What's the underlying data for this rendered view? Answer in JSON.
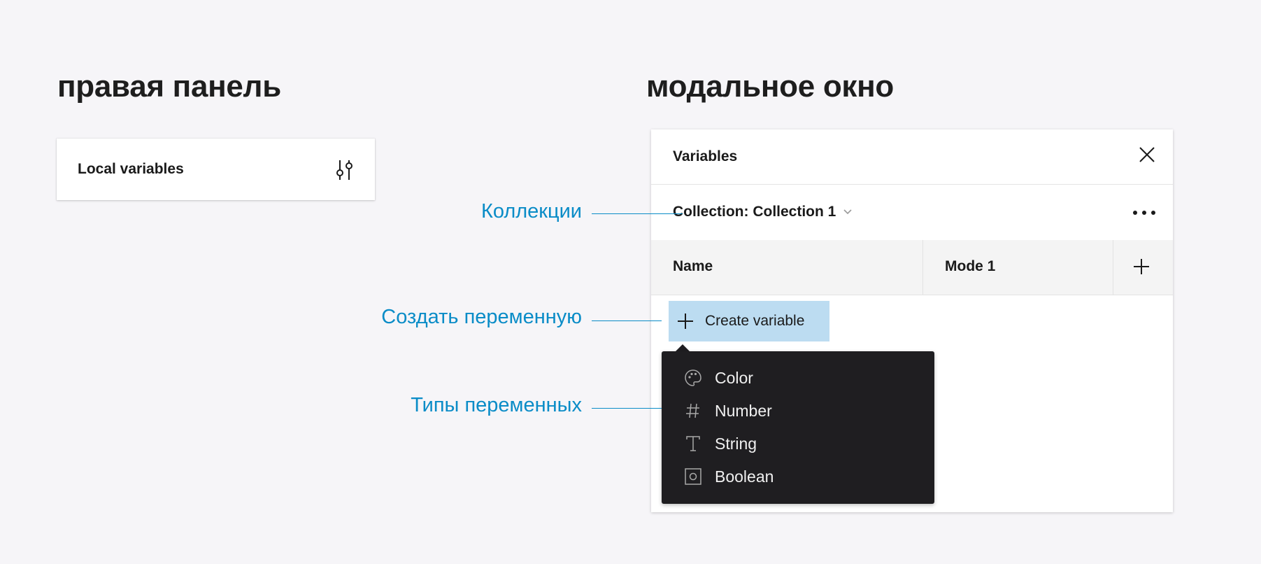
{
  "headings": {
    "left": "правая панель",
    "right": "модальное окно"
  },
  "right_panel": {
    "title": "Local variables",
    "icon": "sliders-icon"
  },
  "modal": {
    "title": "Variables",
    "close_icon": "close-icon",
    "collection_label": "Collection: Collection 1",
    "more_icon": "more-icon",
    "columns": {
      "name": "Name",
      "mode": "Mode 1"
    },
    "add_mode_icon": "plus-icon",
    "create_button": "Create variable"
  },
  "dropdown": {
    "items": [
      {
        "label": "Color",
        "icon": "palette-icon"
      },
      {
        "label": "Number",
        "icon": "hash-icon"
      },
      {
        "label": "String",
        "icon": "text-icon"
      },
      {
        "label": "Boolean",
        "icon": "boolean-icon"
      }
    ]
  },
  "annotations": {
    "collections": "Коллекции",
    "create": "Создать переменную",
    "types": "Типы переменных"
  },
  "colors": {
    "accent": "#0a8cc7",
    "button_highlight": "#bcdcf1",
    "dropdown_bg": "#1f1e21",
    "page_bg": "#f6f5f8"
  }
}
